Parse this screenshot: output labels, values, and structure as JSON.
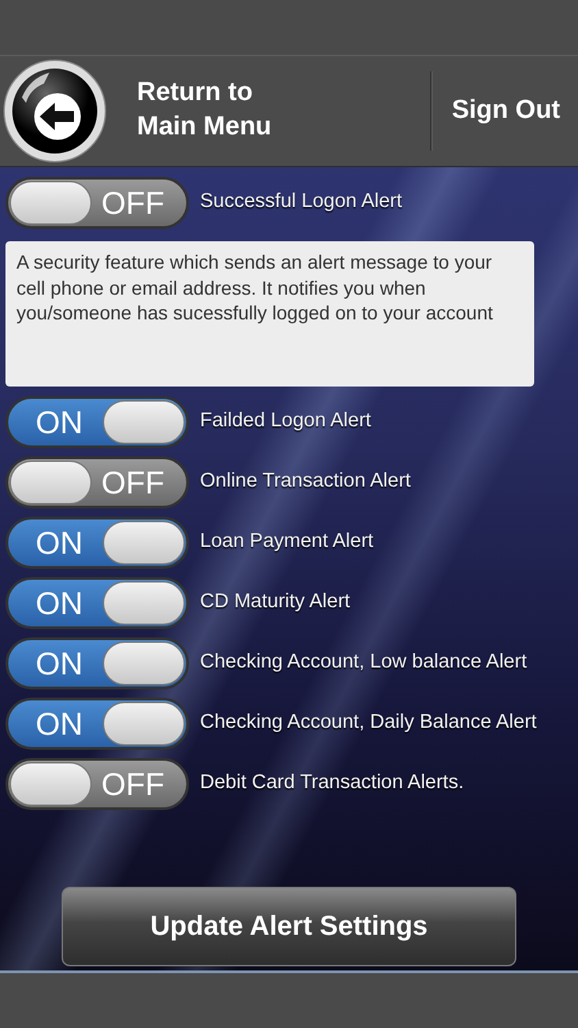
{
  "header": {
    "back_label": "Return to\nMain Menu",
    "sign_out": "Sign Out"
  },
  "alerts": [
    {
      "label": "Successful Logon Alert",
      "on": false,
      "toggle_text": "OFF",
      "description": "A security feature which sends an alert message to your cell phone or email address. It notifies you when you/someone has sucessfully logged on to your account"
    },
    {
      "label": "Failded Logon Alert",
      "on": true,
      "toggle_text": "ON"
    },
    {
      "label": "Online Transaction Alert",
      "on": false,
      "toggle_text": "OFF"
    },
    {
      "label": "Loan Payment Alert",
      "on": true,
      "toggle_text": "ON"
    },
    {
      "label": "CD Maturity Alert",
      "on": true,
      "toggle_text": "ON"
    },
    {
      "label": "Checking Account, Low balance Alert",
      "on": true,
      "toggle_text": "ON"
    },
    {
      "label": "Checking Account, Daily Balance Alert",
      "on": true,
      "toggle_text": "ON"
    },
    {
      "label": "Debit Card Transaction Alerts.",
      "on": false,
      "toggle_text": "OFF"
    }
  ],
  "update_button": "Update Alert Settings"
}
